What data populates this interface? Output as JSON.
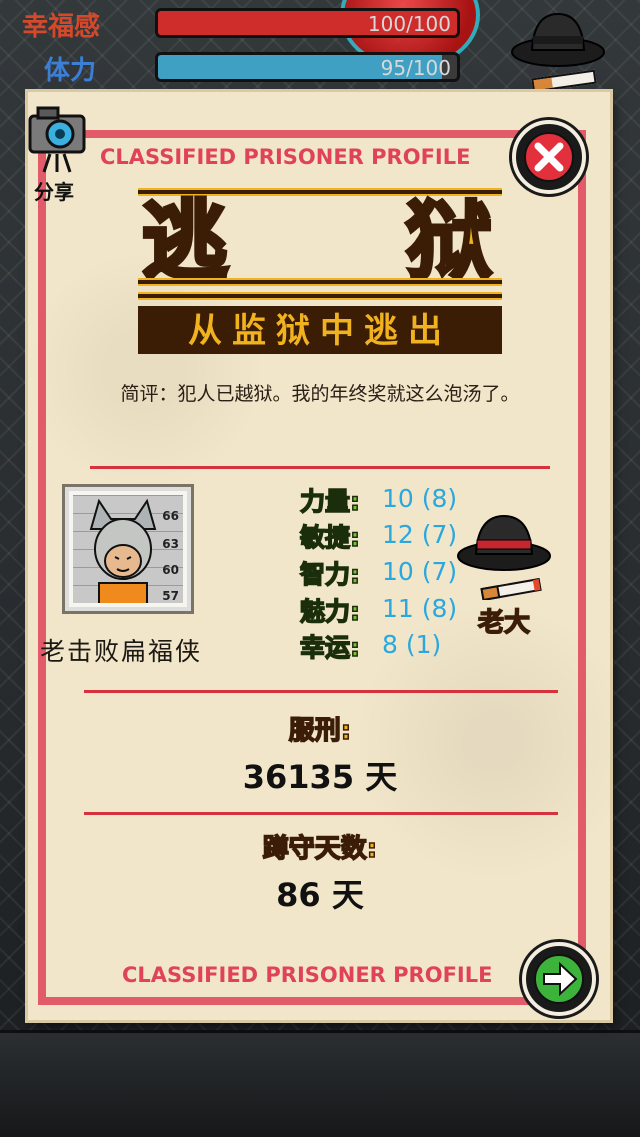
{
  "hud": {
    "happiness_label": "幸福感",
    "happiness_value": "100/100",
    "happiness_fraction": 1.0,
    "stamina_label": "体力",
    "stamina_value": "95/100",
    "stamina_fraction": 0.95,
    "colors": {
      "happiness": "#cf2c2c",
      "stamina": "#3fa0c4",
      "label": "#d5482a",
      "label_blue": "#3b7fd6"
    }
  },
  "share": {
    "label": "分享",
    "icon": "camera-icon"
  },
  "close_button": {
    "icon": "close-icon",
    "color": "#e2303c"
  },
  "next_button": {
    "icon": "arrow-right-icon",
    "color": "#3cb43c"
  },
  "profile": {
    "header": "CLASSIFIED PRISONER PROFILE",
    "footer": "CLASSIFIED PRISONER PROFILE",
    "title_left": "逃",
    "title_right": "狱",
    "subtitle": "从监狱中逃出",
    "review": "简评：犯人已越狱。我的年终奖就这么泡汤了。",
    "mugshot_numbers": [
      "66",
      "63",
      "60",
      "57"
    ],
    "prisoner_name": "老击败扁福侠",
    "stats": [
      {
        "label": "力量:",
        "value": "10 (8)"
      },
      {
        "label": "敏捷:",
        "value": "12 (7)"
      },
      {
        "label": "智力:",
        "value": "10 (7)"
      },
      {
        "label": "魅力:",
        "value": "11 (8)"
      },
      {
        "label": "幸运:",
        "value": "8 (1)"
      }
    ],
    "rank": {
      "label": "老大",
      "icon": "fedora-hat-icon"
    },
    "sentence_label": "服刑:",
    "sentence_value": "36135 天",
    "served_label": "蹲守天数:",
    "served_value": "86 天"
  }
}
